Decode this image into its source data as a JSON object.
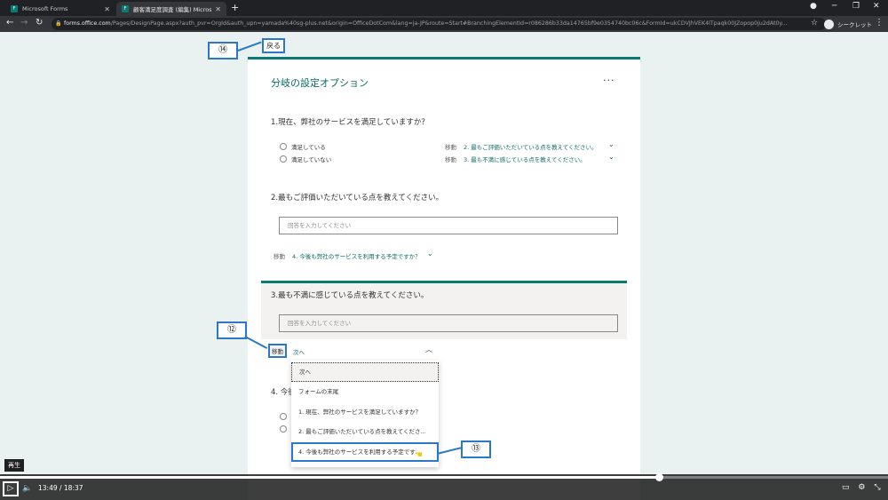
{
  "browser": {
    "tabs": [
      {
        "title": "Microsoft Forms",
        "active": false
      },
      {
        "title": "顧客満足度調査 (編集) Microsoft",
        "active": true
      }
    ],
    "url_host": "forms.office.com",
    "url_path": "/Pages/DesignPage.aspx?auth_pvr=OrgId&auth_upn=yamada%40sg-plus.net&origin=OfficeDotCom&lang=ja-JP&route=Start#BranchingElementId=r086286b33da14765bf9e0354740bc06c&FormId=ukCDVJhVEK4lTpaqk00JZopop0ju2dAt0y...",
    "incognito_label": "シークレット"
  },
  "page": {
    "back_label": "戻る",
    "title": "分岐の設定オプション",
    "more": "...",
    "goto_label": "移動"
  },
  "q1": {
    "title": "1.現在、弊社のサービスを満足していますか？",
    "options": [
      {
        "label": "満足している",
        "goto": "2. 最もご評価いただいている点を教えてください。"
      },
      {
        "label": "満足していない",
        "goto": "3. 最も不満に感じている点を教えてください。"
      }
    ]
  },
  "q2": {
    "title": "2.最もご評価いただいている点を教えてください。",
    "placeholder": "回答を入力してください",
    "goto": "4. 今後も弊社のサービスを利用する予定ですか？"
  },
  "q3": {
    "title": "3.最も不満に感じている点を教えてください。",
    "placeholder": "回答を入力してください",
    "goto_value": "次へ"
  },
  "q4": {
    "title": "4. 今後"
  },
  "dropdown": {
    "items": [
      "次へ",
      "フォームの末尾",
      "1. 現在、弊社のサービスを満足していますか？",
      "2. 最もご評価いただいている点を教えてくださ...",
      "4. 今後も弊社のサービスを利用する予定です..."
    ]
  },
  "callouts": {
    "c12": "⑫",
    "c13": "⑬",
    "c14": "⑭"
  },
  "player": {
    "time": "13:49  /  18:37",
    "tooltip": "再生",
    "progress_fraction": 0.742
  },
  "colors": {
    "accent": "#0b7a75",
    "callout": "#2c78c8"
  }
}
